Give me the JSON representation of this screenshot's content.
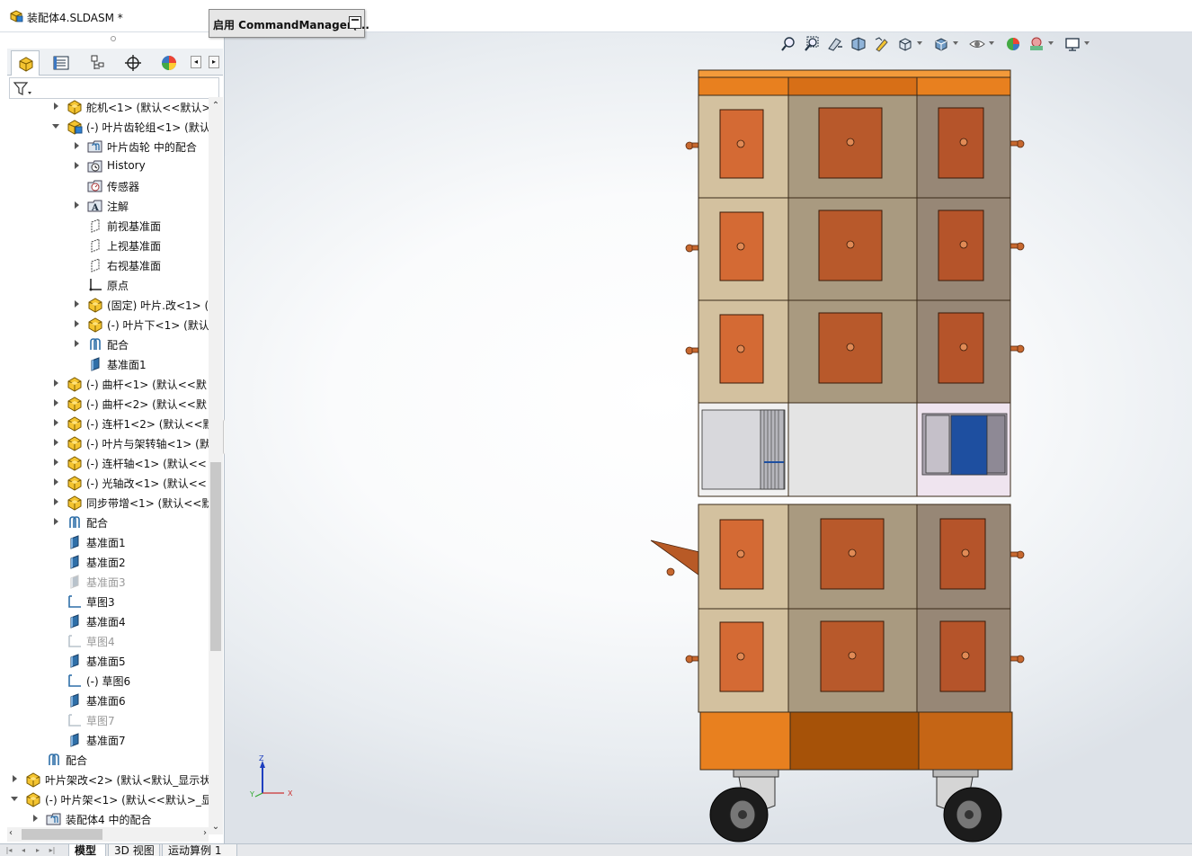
{
  "window": {
    "title": "装配体4.SLDASM *"
  },
  "command_popup": {
    "label": "启用 CommandManager(..."
  },
  "feature_tree": {
    "items": [
      {
        "label": "舵机<1> (默认<<默认>",
        "indent": 3,
        "arrow": "right",
        "icon": "part-icon",
        "dim": false
      },
      {
        "label": "(-) 叶片齿轮组<1> (默认",
        "indent": 3,
        "arrow": "down",
        "icon": "assembly-icon",
        "dim": false
      },
      {
        "label": "叶片齿轮 中的配合",
        "indent": 4,
        "arrow": "right",
        "icon": "mates-folder-icon",
        "dim": false
      },
      {
        "label": "History",
        "indent": 4,
        "arrow": "right",
        "icon": "history-icon",
        "dim": false
      },
      {
        "label": "传感器",
        "indent": 4,
        "arrow": "none",
        "icon": "sensor-icon",
        "dim": false
      },
      {
        "label": "注解",
        "indent": 4,
        "arrow": "right",
        "icon": "annotation-icon",
        "dim": false
      },
      {
        "label": "前视基准面",
        "indent": 4,
        "arrow": "none",
        "icon": "plane-outline-icon",
        "dim": false
      },
      {
        "label": "上视基准面",
        "indent": 4,
        "arrow": "none",
        "icon": "plane-outline-icon",
        "dim": false
      },
      {
        "label": "右视基准面",
        "indent": 4,
        "arrow": "none",
        "icon": "plane-outline-icon",
        "dim": false
      },
      {
        "label": "原点",
        "indent": 4,
        "arrow": "none",
        "icon": "origin-icon",
        "dim": false
      },
      {
        "label": "(固定) 叶片.改<1> (",
        "indent": 4,
        "arrow": "right",
        "icon": "part-icon",
        "dim": false
      },
      {
        "label": "(-) 叶片下<1> (默认",
        "indent": 4,
        "arrow": "right",
        "icon": "part-icon",
        "dim": false
      },
      {
        "label": "配合",
        "indent": 4,
        "arrow": "right",
        "icon": "mates-icon",
        "dim": false
      },
      {
        "label": "基准面1",
        "indent": 4,
        "arrow": "none",
        "icon": "plane-icon",
        "dim": false
      },
      {
        "label": "(-) 曲杆<1> (默认<<默",
        "indent": 3,
        "arrow": "right",
        "icon": "part-icon",
        "dim": false
      },
      {
        "label": "(-) 曲杆<2> (默认<<默",
        "indent": 3,
        "arrow": "right",
        "icon": "part-icon",
        "dim": false
      },
      {
        "label": "(-) 连杆1<2> (默认<<默",
        "indent": 3,
        "arrow": "right",
        "icon": "part-icon",
        "dim": false
      },
      {
        "label": "(-) 叶片与架转轴<1> (默",
        "indent": 3,
        "arrow": "right",
        "icon": "part-icon",
        "dim": false
      },
      {
        "label": "(-) 连杆轴<1> (默认<<",
        "indent": 3,
        "arrow": "right",
        "icon": "part-icon",
        "dim": false
      },
      {
        "label": "(-) 光轴改<1> (默认<<",
        "indent": 3,
        "arrow": "right",
        "icon": "part-icon",
        "dim": false
      },
      {
        "label": "同步带增<1> (默认<<默",
        "indent": 3,
        "arrow": "right",
        "icon": "part-icon",
        "dim": false
      },
      {
        "label": "配合",
        "indent": 3,
        "arrow": "right",
        "icon": "mates-icon",
        "dim": false
      },
      {
        "label": "基准面1",
        "indent": 3,
        "arrow": "none",
        "icon": "plane-icon",
        "dim": false
      },
      {
        "label": "基准面2",
        "indent": 3,
        "arrow": "none",
        "icon": "plane-icon",
        "dim": false
      },
      {
        "label": "基准面3",
        "indent": 3,
        "arrow": "none",
        "icon": "plane-icon",
        "dim": true
      },
      {
        "label": "草图3",
        "indent": 3,
        "arrow": "none",
        "icon": "sketch-icon",
        "dim": false
      },
      {
        "label": "基准面4",
        "indent": 3,
        "arrow": "none",
        "icon": "plane-icon",
        "dim": false
      },
      {
        "label": "草图4",
        "indent": 3,
        "arrow": "none",
        "icon": "sketch-icon",
        "dim": true
      },
      {
        "label": "基准面5",
        "indent": 3,
        "arrow": "none",
        "icon": "plane-icon",
        "dim": false
      },
      {
        "label": "(-) 草图6",
        "indent": 3,
        "arrow": "none",
        "icon": "sketch-icon",
        "dim": false
      },
      {
        "label": "基准面6",
        "indent": 3,
        "arrow": "none",
        "icon": "plane-icon",
        "dim": false
      },
      {
        "label": "草图7",
        "indent": 3,
        "arrow": "none",
        "icon": "sketch-icon",
        "dim": true
      },
      {
        "label": "基准面7",
        "indent": 3,
        "arrow": "none",
        "icon": "plane-icon",
        "dim": false
      },
      {
        "label": "配合",
        "indent": 2,
        "arrow": "none",
        "icon": "mates-icon",
        "dim": false
      },
      {
        "label": "叶片架改<2> (默认<默认_显示状",
        "indent": 1,
        "arrow": "right",
        "icon": "part-icon",
        "dim": false
      },
      {
        "label": "(-) 叶片架<1> (默认<<默认>_显",
        "indent": 1,
        "arrow": "down",
        "icon": "part-icon",
        "dim": false
      },
      {
        "label": "装配体4 中的配合",
        "indent": 2,
        "arrow": "right",
        "icon": "mates-folder-icon",
        "dim": false
      }
    ]
  },
  "bottom_tabs": [
    "模型",
    "3D 视图",
    "运动算例 1"
  ],
  "triad": {
    "z": "Z",
    "y": "Y",
    "x": "X"
  },
  "colors": {
    "part_yellow": "#f4b400",
    "plane_blue": "#2f6fa8",
    "cabinet_orange": "#e07a1f",
    "drawer_brown": "#b75b2e",
    "panel_tan": "#d8c7a4",
    "panel_gray": "#9a8c7c",
    "shutter_blue": "#1e4fa0"
  }
}
